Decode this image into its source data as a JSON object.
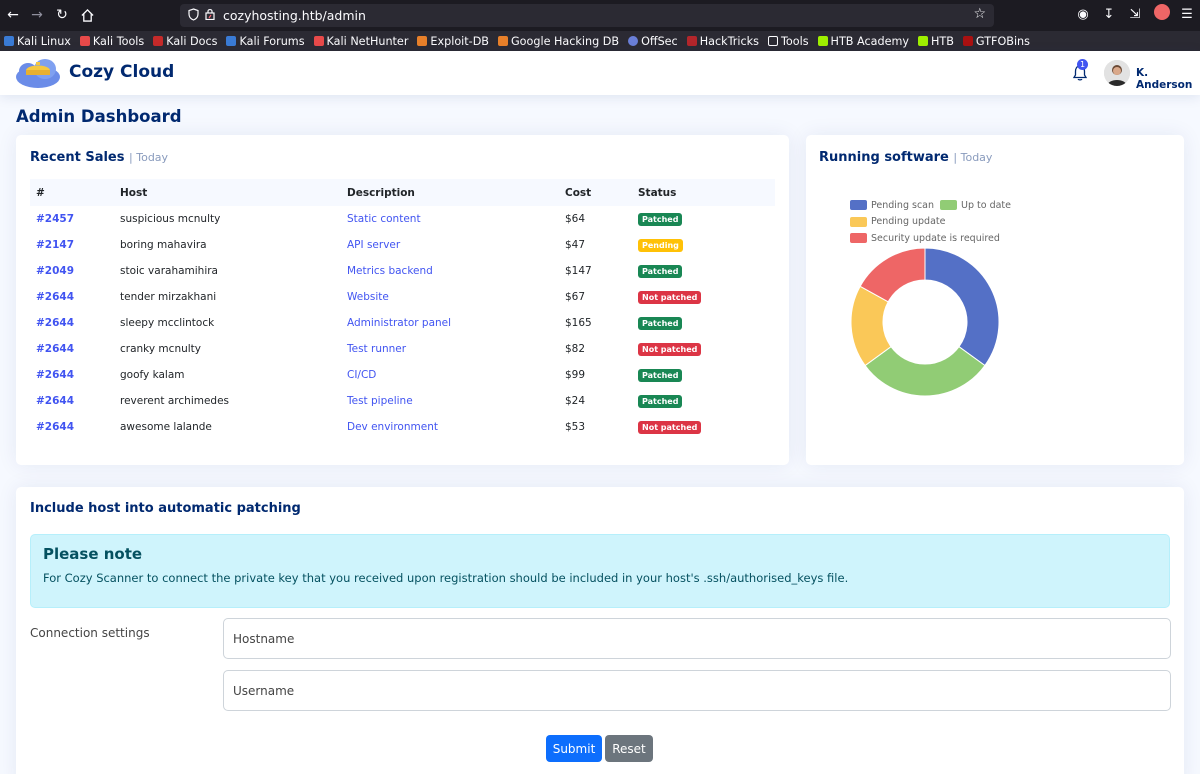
{
  "browser": {
    "url": "cozyhosting.htb/admin",
    "bookmarks": [
      "Kali Linux",
      "Kali Tools",
      "Kali Docs",
      "Kali Forums",
      "Kali NetHunter",
      "Exploit-DB",
      "Google Hacking DB",
      "OffSec",
      "HackTricks",
      "Tools",
      "HTB Academy",
      "HTB",
      "GTFOBins"
    ]
  },
  "header": {
    "brand": "Cozy Cloud",
    "notification_count": "1",
    "user_name": "K. Anderson"
  },
  "page": {
    "title": "Admin Dashboard"
  },
  "sales": {
    "title": "Recent Sales",
    "subtitle": "| Today",
    "columns": [
      "#",
      "Host",
      "Description",
      "Cost",
      "Status"
    ],
    "rows": [
      {
        "id": "#2457",
        "host": "suspicious mcnulty",
        "desc": "Static content",
        "cost": "$64",
        "status": "Patched"
      },
      {
        "id": "#2147",
        "host": "boring mahavira",
        "desc": "API server",
        "cost": "$47",
        "status": "Pending"
      },
      {
        "id": "#2049",
        "host": "stoic varahamihira",
        "desc": "Metrics backend",
        "cost": "$147",
        "status": "Patched"
      },
      {
        "id": "#2644",
        "host": "tender mirzakhani",
        "desc": "Website",
        "cost": "$67",
        "status": "Not patched"
      },
      {
        "id": "#2644",
        "host": "sleepy mcclintock",
        "desc": "Administrator panel",
        "cost": "$165",
        "status": "Patched"
      },
      {
        "id": "#2644",
        "host": "cranky mcnulty",
        "desc": "Test runner",
        "cost": "$82",
        "status": "Not patched"
      },
      {
        "id": "#2644",
        "host": "goofy kalam",
        "desc": "CI/CD",
        "cost": "$99",
        "status": "Patched"
      },
      {
        "id": "#2644",
        "host": "reverent archimedes",
        "desc": "Test pipeline",
        "cost": "$24",
        "status": "Patched"
      },
      {
        "id": "#2644",
        "host": "awesome lalande",
        "desc": "Dev environment",
        "cost": "$53",
        "status": "Not patched"
      }
    ],
    "status_colors": {
      "Patched": "#198754",
      "Pending": "#ffc107",
      "Not patched": "#dc3545"
    }
  },
  "software": {
    "title": "Running software",
    "subtitle": "| Today"
  },
  "chart_data": {
    "type": "pie",
    "categories": [
      "Pending scan",
      "Up to date",
      "Pending update",
      "Security update is required"
    ],
    "values": [
      35,
      30,
      18,
      17
    ],
    "colors": [
      "#5470c6",
      "#91cc75",
      "#fac858",
      "#ee6666"
    ],
    "legend": "top"
  },
  "form": {
    "title": "Include host into automatic patching",
    "note_title": "Please note",
    "note_text": "For Cozy Scanner to connect the private key that you received upon registration should be included in your host's .ssh/authorised_keys file.",
    "connection_label": "Connection settings",
    "hostname_placeholder": "Hostname",
    "username_placeholder": "Username",
    "submit_label": "Submit",
    "reset_label": "Reset"
  }
}
